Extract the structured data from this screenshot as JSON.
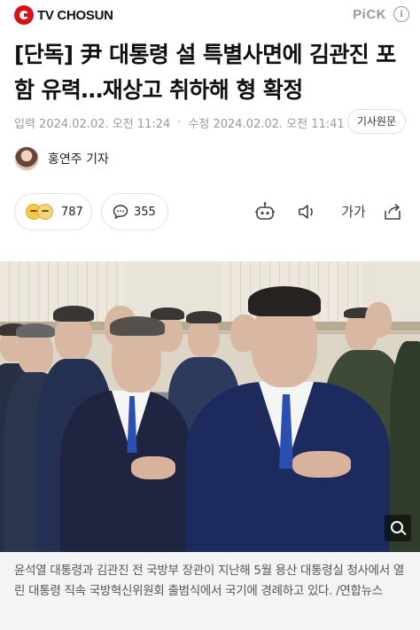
{
  "header": {
    "brand": "TV CHOSUN",
    "pick": "PiCK",
    "info_icon": "ⓘ"
  },
  "article": {
    "title": "[단독] 尹 대통령 설 특별사면에 김관진 포함 유력…재상고 취하해 형 확정",
    "published": "입력 2024.02.02. 오전 11:24",
    "modified": "수정 2024.02.02. 오전 11:41",
    "original_button": "기사원문",
    "reporter": "홍연주 기자"
  },
  "actions": {
    "reactions": "787",
    "comments": "355",
    "font_size_label": "가가",
    "icons": [
      "reaction-emoji-icon",
      "comment-icon",
      "summary-bot-icon",
      "audio-speaker-icon",
      "font-size-icon",
      "share-icon"
    ]
  },
  "photo": {
    "caption": "윤석열 대통령과 김관진 전 국방부 장관이 지난해 5월 용산 대통령실 청사에서 열린 대통령 직속 국방혁신위원회 출범식에서 국기에 경례하고 있다. /연합뉴스"
  },
  "colors": {
    "brand_red": "#d6121b",
    "muted_text": "#999999",
    "caption_bg": "#f3f4f6"
  }
}
